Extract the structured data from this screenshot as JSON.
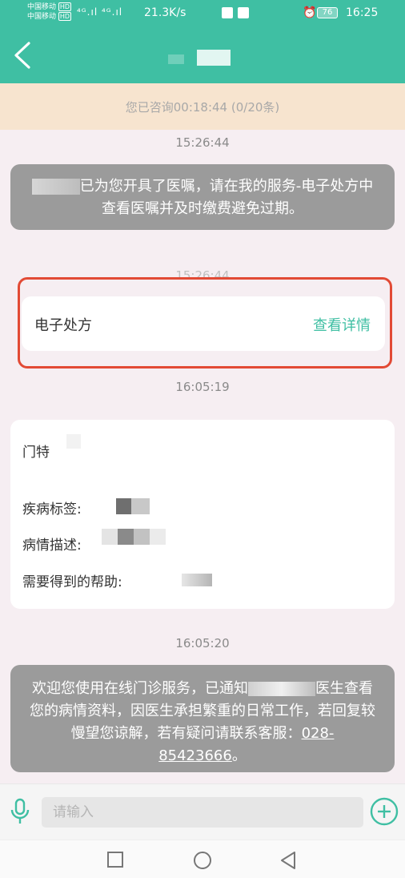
{
  "status_bar": {
    "carrier_1": "中国移动",
    "carrier_2": "中国移动",
    "hd_1": "HD",
    "hd_2": "HD",
    "signal": "⁴ᴳ.ıl ⁴ᴳ.ıl",
    "net_speed": "21.3K/s",
    "battery": "76",
    "time": "16:25"
  },
  "header": {
    "back_icon": "chevron-left-icon"
  },
  "banner": {
    "text": "您已咨询00:18:44 (0/20条)"
  },
  "messages": {
    "t1": "15:26:44",
    "m1": "已为您开具了医嘱，请在我的服务-电子处方中查看医嘱并及时缴费避免过期。",
    "t2": "15:26:44",
    "rx": {
      "title": "电子处方",
      "link": "查看详情"
    },
    "t3": "16:05:19",
    "info": {
      "dept": "门特",
      "disease_label": "疾病标签:",
      "desc_label": "病情描述:",
      "help_label": "需要得到的帮助:"
    },
    "t4": "16:05:20",
    "m2_part1": "欢迎您使用在线门诊服务，已通知",
    "m2_part2": "医生查看您的病情资料，因医生承担繁重的日常工作，若回复较慢望您谅解，若有疑问请联系客服：",
    "m2_phone": "028-85423666",
    "m2_end": "。"
  },
  "input": {
    "placeholder": "请输入"
  },
  "colors": {
    "primary": "#3fbfa3",
    "highlight": "#e24a35",
    "bubble": "#9b9b9b",
    "banner": "#f7e4cf"
  }
}
